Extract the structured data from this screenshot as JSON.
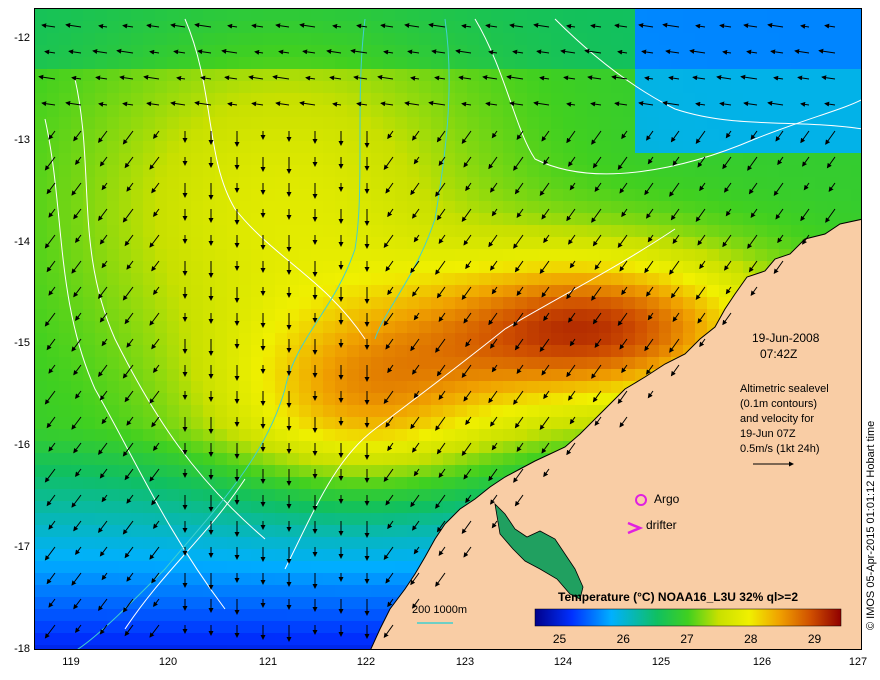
{
  "map": {
    "y_ticks": [
      "-12",
      "-13",
      "-14",
      "-15",
      "-16",
      "-17",
      "-18"
    ],
    "x_ticks": [
      "119",
      "120",
      "121",
      "122",
      "123",
      "124",
      "125",
      "126",
      "127"
    ],
    "lat_range": [
      -18,
      -11.75
    ],
    "lon_range": [
      118.6,
      127
    ]
  },
  "annotations": {
    "date": "19-Jun-2008",
    "time": "07:42Z",
    "desc_line1": "Altimetric sealevel",
    "desc_line2": "(0.1m contours)",
    "desc_line3": "and velocity for",
    "desc_line4": "19-Jun 07Z",
    "speed_scale": "0.5m/s (1kt 24h)",
    "argo_label": "Argo",
    "drifter_label": "drifter",
    "drifter_symbol": ">",
    "depth_label": "200  1000m"
  },
  "colorbar": {
    "title": "Temperature (°C) NOAA16_L3U 32% ql>=2",
    "ticks": [
      "25",
      "26",
      "27",
      "28",
      "29"
    ],
    "tick_values": [
      25,
      26,
      27,
      28,
      29
    ],
    "range": [
      24.6,
      29.4
    ]
  },
  "credit": "© IMOS 05-Apr-2015 01:01:12 Hobart time",
  "colors": {
    "land": "#f9cda5",
    "argo": "#e020e0",
    "drifter": "#e020e0",
    "bathy": "#40d0d0",
    "sealevel_contour": "#ffffff"
  }
}
